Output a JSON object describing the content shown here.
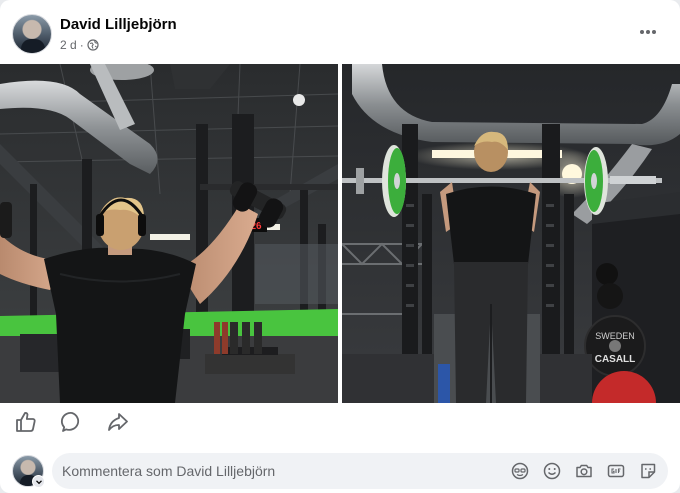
{
  "post": {
    "author": "David Lilljebjörn",
    "time": "2 d",
    "separator": "·",
    "audience_icon": "globe-icon",
    "more_icon": "more-options-icon"
  },
  "photos": [
    {
      "icon": "photo-gym-dumbbells"
    },
    {
      "icon": "photo-gym-barbell-rack"
    }
  ],
  "photo_text": {
    "timer_readout": "26",
    "plate_brand": "CASALL",
    "plate_brand_2": "SWEDEN"
  },
  "actions": {
    "like_icon": "thumbs-up-icon",
    "comment_icon": "comment-bubble-icon",
    "share_icon": "share-arrow-icon"
  },
  "comment": {
    "placeholder": "Kommentera som David Lilljebjörn",
    "tools": [
      "avatar-sticker-icon",
      "emoji-icon",
      "camera-icon",
      "gif-icon",
      "sticker-icon"
    ]
  },
  "colors": {
    "text_primary": "#050505",
    "text_secondary": "#65676b",
    "comment_bg": "#f0f2f5",
    "gym_floor": "#49c43f",
    "plate_green": "#3cae3c",
    "plate_red": "#c42a2a"
  }
}
